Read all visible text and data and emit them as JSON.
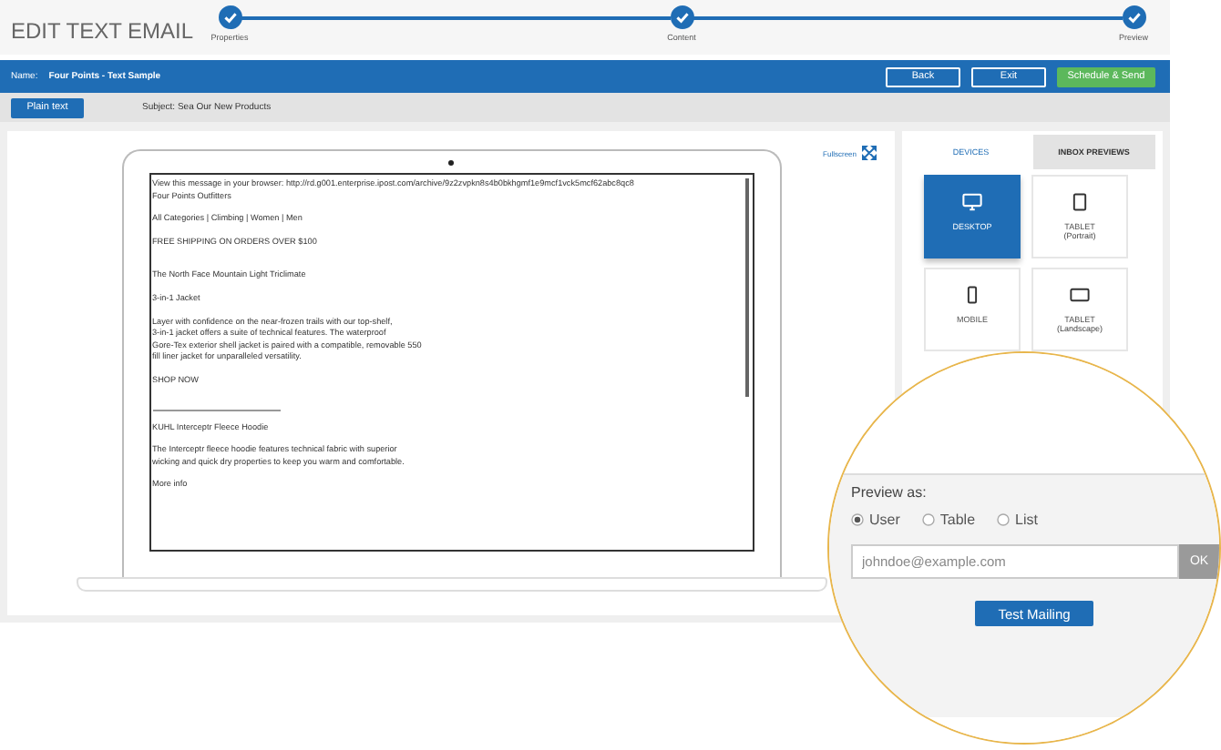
{
  "header": {
    "title": "EDIT TEXT EMAIL",
    "steps": [
      {
        "label": "Properties",
        "completed": true
      },
      {
        "label": "Content",
        "completed": true
      },
      {
        "label": "Preview",
        "completed": true
      }
    ]
  },
  "toolbar": {
    "name_label": "Name:",
    "name_value": "Four Points - Text Sample",
    "buttons": [
      {
        "label": "Back",
        "kind": "outline"
      },
      {
        "label": "Exit",
        "kind": "outline"
      },
      {
        "label": "Schedule & Send",
        "kind": "primary"
      }
    ]
  },
  "subbar": {
    "format_button": "Plain text",
    "subject": "Subject: Sea Our New Products"
  },
  "preview": {
    "fullscreen_label": "Fullscreen",
    "blocks": [
      {
        "kind": "text",
        "lines": [
          "View this message in your browser: http://rd.g001.enterprise.ipost.com/archive/9z2zvpkn8s4b0bkhgmf1e9mcf1vck5mcf62abc8qc8",
          "Four Points Outfitters"
        ]
      },
      {
        "kind": "text",
        "lines": [
          "All Categories | Climbing | Women | Men"
        ]
      },
      {
        "kind": "text",
        "lines": [
          "FREE SHIPPING ON ORDERS OVER $100"
        ]
      },
      {
        "kind": "gap"
      },
      {
        "kind": "text",
        "lines": [
          "The North Face Mountain Light Triclimate"
        ]
      },
      {
        "kind": "text",
        "lines": [
          "3-in-1 Jacket"
        ]
      },
      {
        "kind": "text",
        "lines": [
          "Layer with confidence on the near-frozen trails with our top-shelf,",
          "3-in-1 jacket offers a suite of technical features. The waterproof",
          "Gore-Tex exterior shell jacket is paired with a compatible, removable 550",
          "fill liner jacket for unparalleled versatility."
        ]
      },
      {
        "kind": "text",
        "lines": [
          "SHOP NOW"
        ]
      },
      {
        "kind": "gap"
      },
      {
        "kind": "rule"
      },
      {
        "kind": "text",
        "lines": [
          "KUHL Interceptr Fleece Hoodie"
        ]
      },
      {
        "kind": "text",
        "lines": [
          "The Interceptr fleece hoodie features technical fabric with superior",
          "wicking and quick dry properties to keep you warm and comfortable."
        ]
      },
      {
        "kind": "text",
        "lines": [
          "More info"
        ]
      }
    ]
  },
  "side_panel": {
    "tabs": [
      {
        "label": "DEVICES",
        "selected": true
      },
      {
        "label": "INBOX PREVIEWS",
        "selected": false
      }
    ],
    "devices": [
      {
        "kind": "desktop",
        "label": "DESKTOP",
        "selected": true
      },
      {
        "kind": "tablet",
        "label": "TABLET",
        "sublabel": "(Portrait)",
        "selected": false
      },
      {
        "kind": "mobile",
        "label": "MOBILE",
        "selected": false
      },
      {
        "kind": "tablet-landscape",
        "label": "TABLET",
        "sublabel": "(Landscape)",
        "selected": false
      }
    ]
  },
  "magnifier": {
    "preview_as_label": "Preview as:",
    "options": [
      {
        "label": "User",
        "selected": true
      },
      {
        "label": "Table",
        "selected": false
      },
      {
        "label": "List",
        "selected": false
      }
    ],
    "email_field": {
      "placeholder": "johndoe@example.com"
    },
    "ok_button": {
      "label": "OK",
      "disabled": true
    },
    "test_button": "Test Mailing"
  }
}
